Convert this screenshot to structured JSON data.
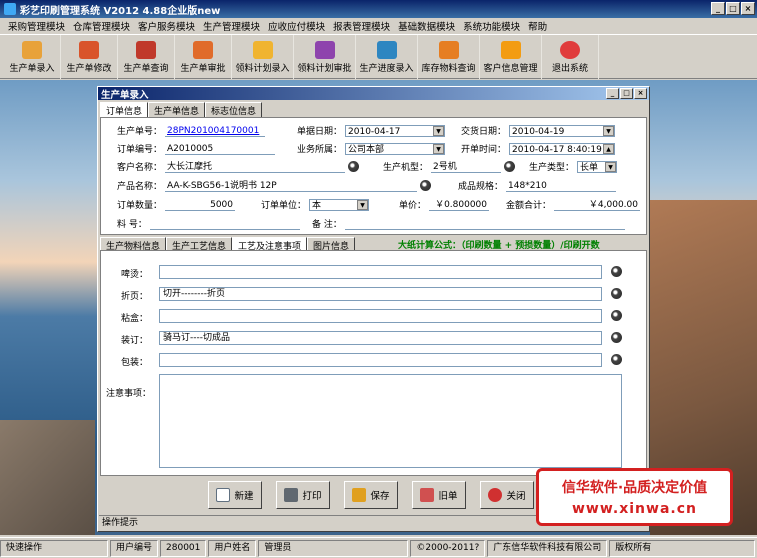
{
  "app": {
    "title": "彩艺印刷管理系统  V2012 4.88企业版new"
  },
  "menu": [
    "采购管理模块",
    "仓库管理模块",
    "客户服务模块",
    "生产管理模块",
    "应收应付模块",
    "报表管理模块",
    "基础数据模块",
    "系统功能模块",
    "帮助"
  ],
  "toolbar": [
    {
      "label": "生产单录入",
      "icon": "order-entry-icon",
      "color": "#e8a23a"
    },
    {
      "label": "生产单修改",
      "icon": "order-edit-icon",
      "color": "#d9542b"
    },
    {
      "label": "生产单查询",
      "icon": "order-query-icon",
      "color": "#c0392b"
    },
    {
      "label": "生产单审批",
      "icon": "order-approve-icon",
      "color": "#e06b2a"
    },
    {
      "label": "领料计划录入",
      "icon": "material-plan-icon",
      "color": "#f0b430"
    },
    {
      "label": "领料计划审批",
      "icon": "material-approve-icon",
      "color": "#8e44ad"
    },
    {
      "label": "生产进度录入",
      "icon": "progress-icon",
      "color": "#2e86c1"
    },
    {
      "label": "库存物料查询",
      "icon": "inventory-icon",
      "color": "#e67e22"
    },
    {
      "label": "客户信息管理",
      "icon": "customer-icon",
      "color": "#f39c12"
    },
    {
      "label": "退出系统",
      "icon": "exit-icon",
      "color": "#e03c3c"
    }
  ],
  "window": {
    "title": "生产单录入",
    "tabs_top": [
      "订单信息",
      "生产单信息",
      "标志位信息"
    ],
    "fields": {
      "order_no_label": "生产单号：",
      "order_no": "28PN201004170001",
      "doc_date_label": "单据日期：",
      "doc_date": "2010-04-17",
      "delivery_date_label": "交货日期：",
      "delivery_date": "2010-04-19",
      "order_code_label": "订单编号：",
      "order_code": "A2010005",
      "business_label": "业务所属：",
      "business": "公司本部",
      "open_time_label": "开单时间：",
      "open_time": "2010-04-17 8:40:19",
      "customer_label": "客户名称：",
      "customer": "大长江摩托",
      "machine_label": "生产机型：",
      "machine": "2号机",
      "prod_type_label": "生产类型：",
      "prod_type": "长单",
      "product_label": "产品名称：",
      "product": "AA-K-SBG56-1说明书      12P",
      "spec_label": "成品规格：",
      "spec": "148*210",
      "qty_label": "订单数量：",
      "qty": "5000",
      "unit_label": "订单单位：",
      "unit": "本",
      "price_label": "单价：",
      "price": "￥0.800000",
      "amount_label": "金额合计：",
      "amount": "￥4,000.00",
      "material_label": "料  号：",
      "material": "",
      "remark_label": "备 注：",
      "remark": ""
    },
    "tabs_mid": [
      "生产物料信息",
      "生产工艺信息",
      "工艺及注意事项",
      "图片信息"
    ],
    "formula": "大纸计算公式：（印刷数量 + 预损数量）/印刷开数",
    "process": [
      {
        "label": "啤烫：",
        "value": ""
      },
      {
        "label": "折页：",
        "value": "切开--------折页"
      },
      {
        "label": "粘盒：",
        "value": ""
      },
      {
        "label": "装订：",
        "value": "骑马订----切成品"
      },
      {
        "label": "包装：",
        "value": ""
      }
    ],
    "notes_label": "注意事项：",
    "buttons": [
      "新建",
      "打印",
      "保存",
      "旧单",
      "关闭"
    ],
    "hint": "操作提示"
  },
  "banner": {
    "line1": "信华软件·品质决定价值",
    "line2": "www.xinwa.cn"
  },
  "status": [
    "快速操作",
    "用户编号",
    "280001",
    "用户姓名",
    "管理员",
    "©2000-2011?",
    "广东信华软件科技有限公司",
    "版权所有"
  ]
}
